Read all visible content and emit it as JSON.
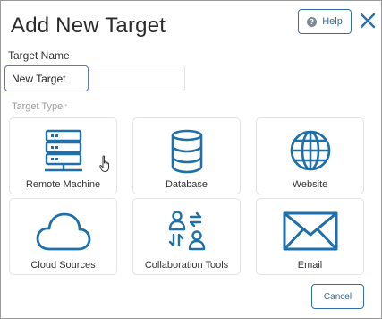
{
  "dialog": {
    "title": "Add New Target",
    "help_label": "Help",
    "help_icon": "question-circle-icon",
    "close_icon": "close-icon"
  },
  "target_name": {
    "label": "Target Name",
    "value": "New Target"
  },
  "target_type": {
    "label": "Target Type",
    "options": [
      {
        "label": "Remote Machine",
        "icon": "server-icon"
      },
      {
        "label": "Database",
        "icon": "database-icon"
      },
      {
        "label": "Website",
        "icon": "globe-icon"
      },
      {
        "label": "Cloud Sources",
        "icon": "cloud-icon"
      },
      {
        "label": "Collaboration Tools",
        "icon": "users-exchange-icon"
      },
      {
        "label": "Email",
        "icon": "envelope-icon"
      }
    ]
  },
  "footer": {
    "cancel_label": "Cancel"
  },
  "colors": {
    "accent": "#2e6fa7",
    "icon": "#1f6fa8",
    "input_focus": "#5b77d6",
    "tile_border": "#e3e3e3"
  }
}
